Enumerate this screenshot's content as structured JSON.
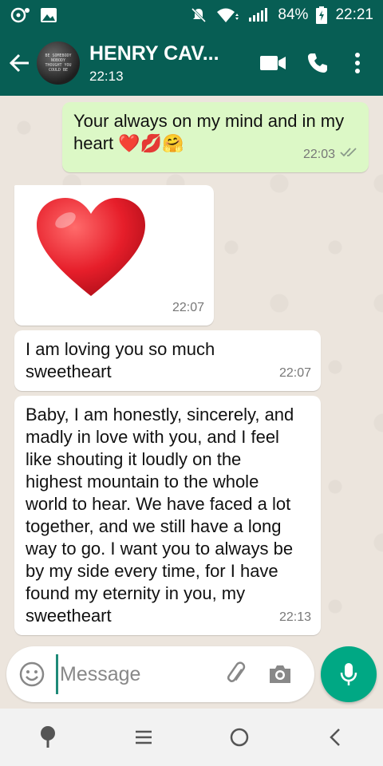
{
  "status_bar": {
    "battery": "84%",
    "time": "22:21"
  },
  "header": {
    "contact_name": "HENRY CAV...",
    "subtitle": "22:13",
    "avatar_text": "BE SOMEBODY NOBODY THOUGHT YOU COULD BE"
  },
  "messages": [
    {
      "direction": "out",
      "text": "Your always on my mind and in my heart ❤️💋🤗",
      "time": "22:03",
      "status": "read"
    },
    {
      "direction": "in",
      "type": "sticker",
      "text": "❤️",
      "time": "22:07"
    },
    {
      "direction": "in",
      "text": "I am loving you so much sweetheart",
      "time": "22:07"
    },
    {
      "direction": "in",
      "text": "Baby, I am honestly, sincerely, and madly in love with you, and I feel like shouting it loudly on the highest mountain to the whole world to hear. We have faced a lot together, and we still have a long way to go. I want you to always be by my side every time, for I have found my eternity in you, my sweetheart",
      "time": "22:13"
    }
  ],
  "composer": {
    "placeholder": "Message"
  },
  "colors": {
    "header": "#075e54",
    "outgoing": "#dcf8c6",
    "incoming": "#ffffff",
    "accent": "#00a884"
  },
  "icons": {
    "status_left": [
      "chat-bubble-icon",
      "image-icon"
    ],
    "status_right": [
      "mute-icon",
      "wifi-icon",
      "signal-icon",
      "battery-icon"
    ],
    "header": [
      "back-arrow-icon",
      "video-call-icon",
      "phone-icon",
      "more-vert-icon"
    ],
    "composer": [
      "emoji-icon",
      "attach-icon",
      "camera-icon",
      "mic-icon"
    ],
    "nav": [
      "pin-icon",
      "menu-icon",
      "home-icon",
      "back-icon"
    ]
  }
}
